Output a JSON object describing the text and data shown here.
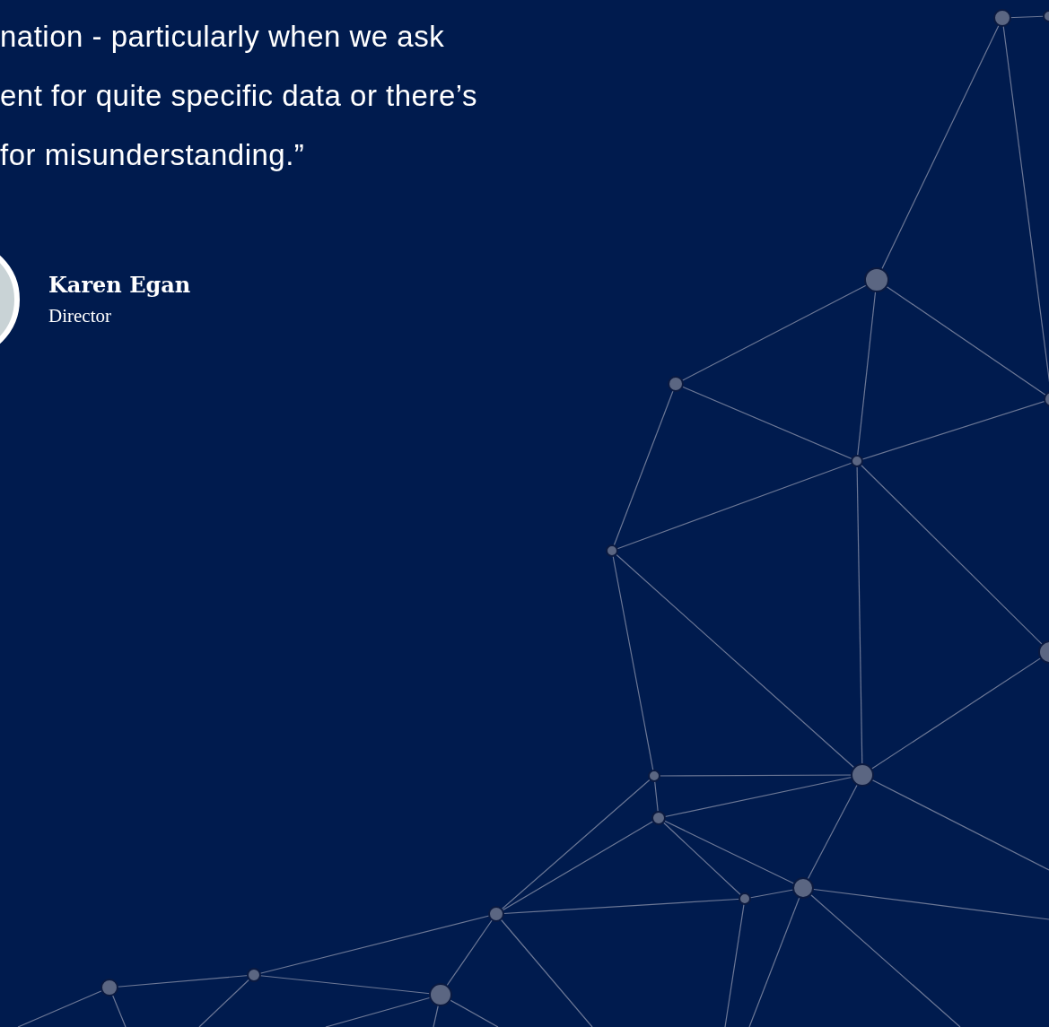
{
  "quote_lines": [
    "nation - particularly when we ask",
    "ent for quite specific data or there’s",
    "for misunderstanding.”"
  ],
  "author": {
    "name": "Karen Egan",
    "role": "Director"
  }
}
